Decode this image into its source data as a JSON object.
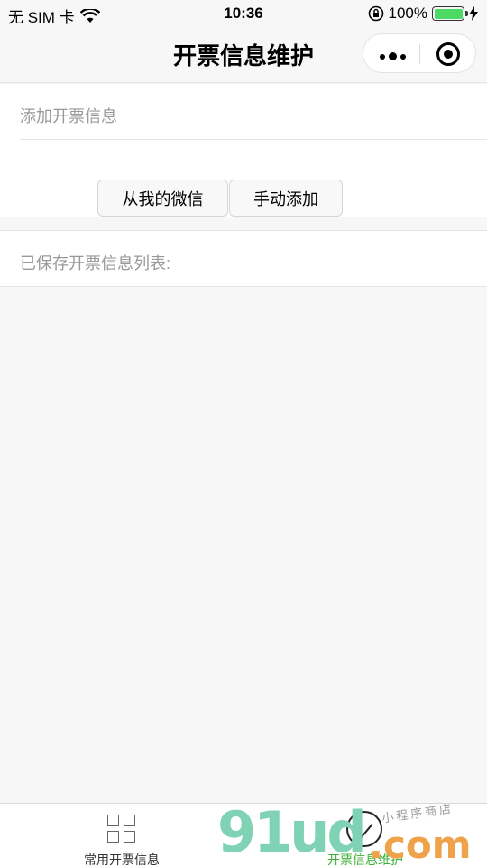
{
  "status_bar": {
    "carrier": "无 SIM 卡",
    "time": "10:36",
    "battery": "100%",
    "battery_level": 1.0
  },
  "nav": {
    "title": "开票信息维护"
  },
  "add_section": {
    "label": "添加开票信息",
    "btn_wechat": "从我的微信",
    "btn_manual": "手动添加"
  },
  "saved_section": {
    "label": "已保存开票信息列表:"
  },
  "tab_bar": {
    "items": [
      {
        "label": "常用开票信息",
        "icon": "grid-icon",
        "color": "#333333"
      },
      {
        "label": "开票信息维护",
        "icon": "check-circle-icon",
        "color": "#3cb034"
      }
    ]
  },
  "watermark": {
    "brand": "91ud",
    "domain": ".com",
    "slogan": "小程序商店"
  },
  "colors": {
    "active_tab": "#3cb034",
    "battery_fill": "#4cd964",
    "background": "#f7f7f7"
  }
}
